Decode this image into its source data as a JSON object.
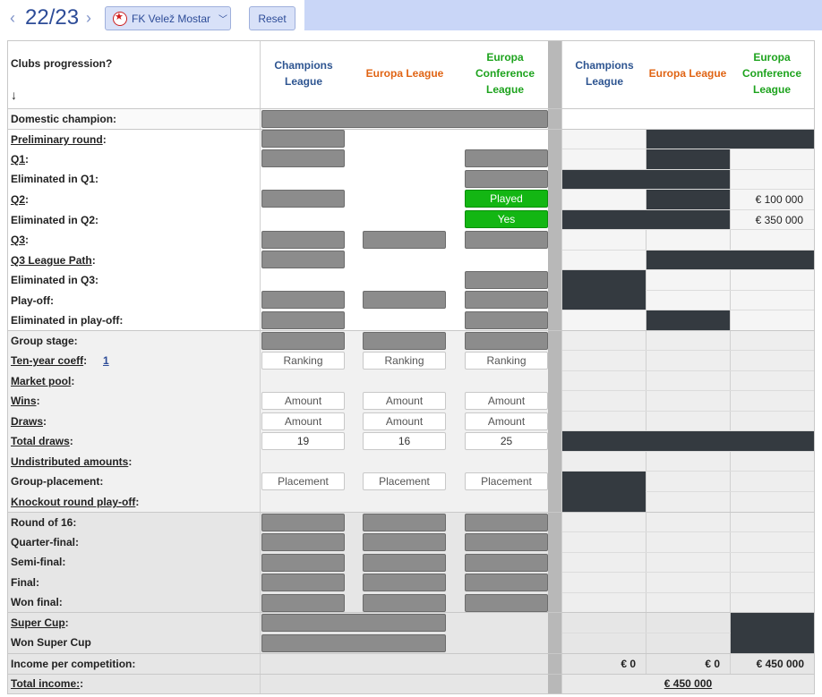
{
  "header": {
    "season": "22/23",
    "prev_arrow": "‹",
    "next_arrow": "›",
    "club": "FK Velež Mostar",
    "reset_label": "Reset"
  },
  "table": {
    "question": "Clubs progression?",
    "arrow": "↓",
    "columns": {
      "cl": "Champions League",
      "el": "Europa League",
      "ecl": "Europa Conference League"
    },
    "rows": {
      "domestic": "Domestic champion:",
      "prelim": "Preliminary round",
      "q1": "Q1",
      "elim_q1": "Eliminated in Q1:",
      "q2": "Q2",
      "elim_q2": "Eliminated in Q2:",
      "q3": "Q3",
      "q3_league": "Q3 League Path",
      "elim_q3": "Eliminated in Q3:",
      "playoff": "Play-off:",
      "elim_playoff": "Eliminated in play-off:",
      "group_stage": "Group stage:",
      "ten_year": "Ten-year coeff",
      "ten_year_link": "1",
      "market_pool": "Market pool",
      "wins": "Wins",
      "draws": "Draws",
      "total_draws": "Total draws",
      "undistributed": "Undistributed amounts",
      "group_placement": "Group-placement:",
      "ko_playoff": "Knockout round play-off",
      "r16": "Round of 16:",
      "qf": "Quarter-final:",
      "sf": "Semi-final:",
      "final": "Final:",
      "won_final": "Won final:",
      "super_cup": "Super Cup",
      "won_super_cup": "Won Super Cup",
      "income_per": "Income per competition:",
      "total_income": "Total income:"
    },
    "inputs": {
      "played": "Played",
      "yes": "Yes",
      "ranking": "Ranking",
      "amount": "Amount",
      "placement": "Placement",
      "total_draws_cl": "19",
      "total_draws_el": "16",
      "total_draws_ecl": "25"
    },
    "money": {
      "ecl_q2": "€ 100 000",
      "ecl_elim_q2": "€ 350 000",
      "income_cl": "€ 0",
      "income_el": "€ 0",
      "income_ecl": "€ 450 000",
      "total": "€ 450 000"
    }
  },
  "colors": {
    "accent": "#2d4c98",
    "cl": "#2e5591",
    "el": "#e06414",
    "ecl": "#1ea31e",
    "played_green": "#13b613",
    "grey_bar": "#8c8c8c",
    "dark_cell": "#343a40"
  }
}
